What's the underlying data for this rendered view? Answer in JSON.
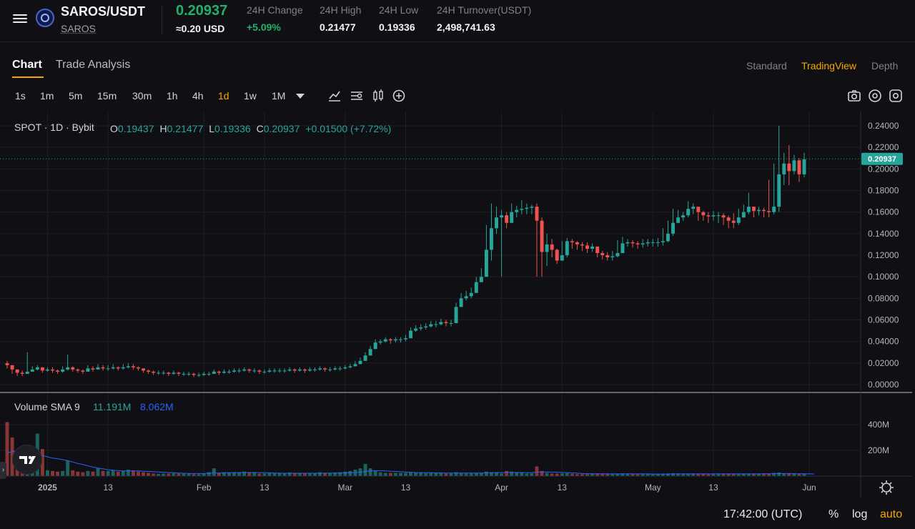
{
  "header": {
    "pair": "SAROS/USDT",
    "subtitle": "SAROS",
    "last_price": "0.20937",
    "price_usd": "≈0.20 USD",
    "stats": [
      {
        "label": "24H Change",
        "value": "+5.09%",
        "positive": true
      },
      {
        "label": "24H High",
        "value": "0.21477",
        "positive": false
      },
      {
        "label": "24H Low",
        "value": "0.19336",
        "positive": false
      },
      {
        "label": "24H Turnover(USDT)",
        "value": "2,498,741.63",
        "positive": false
      }
    ]
  },
  "tabs": {
    "chart": "Chart",
    "trade_analysis": "Trade Analysis",
    "views": [
      "Standard",
      "TradingView",
      "Depth"
    ],
    "active_view": "TradingView"
  },
  "toolbar": {
    "timeframes": [
      "1s",
      "1m",
      "5m",
      "15m",
      "30m",
      "1h",
      "4h",
      "1d",
      "1w",
      "1M"
    ],
    "active_timeframe": "1d",
    "icons": [
      "chevron-down-icon",
      "line-chart-icon",
      "indicator-icon",
      "candle-type-icon",
      "add-icon",
      "camera-icon",
      "eye-icon",
      "settings-icon"
    ]
  },
  "legend": {
    "source": "SPOT · 1D · Bybit",
    "open_label": "O",
    "open": "0.19437",
    "high_label": "H",
    "high": "0.21477",
    "low_label": "L",
    "low": "0.19336",
    "close_label": "C",
    "close": "0.20937",
    "change": "+0.01500 (+7.72%)",
    "volume_title": "Volume SMA 9",
    "volume_value": "11.191M",
    "volume_sma": "8.062M"
  },
  "colors": {
    "up": "#26a69a",
    "down": "#ef5350",
    "accent": "#f7a600",
    "green_text": "#20b26c",
    "sma": "#2962ff"
  },
  "chart_data": {
    "type": "candlestick",
    "price_axis_ticks": [
      "0.24000",
      "0.22000",
      "0.20000",
      "0.18000",
      "0.16000",
      "0.14000",
      "0.12000",
      "0.10000",
      "0.08000",
      "0.06000",
      "0.04000",
      "0.02000",
      "0.00000"
    ],
    "price_range": [
      0,
      0.24
    ],
    "current_price_label": "0.20937",
    "volume_axis_ticks": [
      "400M",
      "200M"
    ],
    "volume_range": [
      0,
      400
    ],
    "time_ticks": [
      {
        "label": "2025",
        "day": 8
      },
      {
        "label": "13",
        "day": 20
      },
      {
        "label": "Feb",
        "day": 39
      },
      {
        "label": "13",
        "day": 51
      },
      {
        "label": "Mar",
        "day": 67
      },
      {
        "label": "13",
        "day": 79
      },
      {
        "label": "Apr",
        "day": 98
      },
      {
        "label": "13",
        "day": 110
      },
      {
        "label": "May",
        "day": 128
      },
      {
        "label": "13",
        "day": 140
      },
      {
        "label": "Jun",
        "day": 159
      }
    ],
    "closes": [
      0.018,
      0.014,
      0.011,
      0.01,
      0.012,
      0.014,
      0.016,
      0.013,
      0.014,
      0.013,
      0.012,
      0.014,
      0.016,
      0.014,
      0.013,
      0.012,
      0.015,
      0.014,
      0.016,
      0.015,
      0.015,
      0.016,
      0.015,
      0.016,
      0.017,
      0.016,
      0.015,
      0.013,
      0.012,
      0.011,
      0.011,
      0.011,
      0.01,
      0.011,
      0.01,
      0.01,
      0.01,
      0.009,
      0.009,
      0.01,
      0.01,
      0.012,
      0.011,
      0.012,
      0.012,
      0.013,
      0.013,
      0.014,
      0.013,
      0.013,
      0.012,
      0.012,
      0.013,
      0.013,
      0.013,
      0.013,
      0.014,
      0.013,
      0.014,
      0.013,
      0.014,
      0.014,
      0.015,
      0.014,
      0.014,
      0.015,
      0.015,
      0.016,
      0.017,
      0.019,
      0.022,
      0.027,
      0.033,
      0.039,
      0.04,
      0.042,
      0.041,
      0.042,
      0.042,
      0.043,
      0.05,
      0.052,
      0.053,
      0.054,
      0.056,
      0.056,
      0.058,
      0.057,
      0.057,
      0.072,
      0.08,
      0.082,
      0.085,
      0.095,
      0.1,
      0.125,
      0.145,
      0.155,
      0.157,
      0.15,
      0.16,
      0.162,
      0.163,
      0.164,
      0.165,
      0.152,
      0.123,
      0.13,
      0.125,
      0.115,
      0.12,
      0.133,
      0.132,
      0.13,
      0.129,
      0.126,
      0.128,
      0.122,
      0.12,
      0.118,
      0.119,
      0.122,
      0.131,
      0.132,
      0.131,
      0.13,
      0.131,
      0.132,
      0.132,
      0.132,
      0.133,
      0.14,
      0.15,
      0.155,
      0.157,
      0.163,
      0.165,
      0.16,
      0.157,
      0.156,
      0.157,
      0.157,
      0.155,
      0.152,
      0.15,
      0.155,
      0.16,
      0.165,
      0.161,
      0.162,
      0.161,
      0.16,
      0.165,
      0.195,
      0.205,
      0.198,
      0.208,
      0.195,
      0.209
    ],
    "highs": [
      0.022,
      0.016,
      0.014,
      0.013,
      0.03,
      0.017,
      0.018,
      0.016,
      0.016,
      0.016,
      0.014,
      0.017,
      0.028,
      0.017,
      0.015,
      0.014,
      0.018,
      0.017,
      0.019,
      0.018,
      0.018,
      0.019,
      0.017,
      0.019,
      0.02,
      0.019,
      0.017,
      0.015,
      0.014,
      0.013,
      0.013,
      0.013,
      0.012,
      0.013,
      0.012,
      0.012,
      0.012,
      0.011,
      0.011,
      0.012,
      0.012,
      0.014,
      0.013,
      0.014,
      0.014,
      0.015,
      0.015,
      0.016,
      0.015,
      0.015,
      0.014,
      0.014,
      0.015,
      0.015,
      0.015,
      0.015,
      0.016,
      0.015,
      0.016,
      0.015,
      0.016,
      0.016,
      0.017,
      0.016,
      0.016,
      0.017,
      0.017,
      0.018,
      0.019,
      0.022,
      0.025,
      0.03,
      0.036,
      0.042,
      0.042,
      0.044,
      0.043,
      0.044,
      0.044,
      0.046,
      0.053,
      0.055,
      0.056,
      0.057,
      0.059,
      0.059,
      0.061,
      0.06,
      0.06,
      0.076,
      0.085,
      0.087,
      0.09,
      0.1,
      0.108,
      0.148,
      0.168,
      0.165,
      0.162,
      0.16,
      0.168,
      0.166,
      0.171,
      0.168,
      0.167,
      0.168,
      0.155,
      0.14,
      0.135,
      0.126,
      0.133,
      0.136,
      0.135,
      0.133,
      0.132,
      0.132,
      0.131,
      0.127,
      0.124,
      0.123,
      0.124,
      0.134,
      0.137,
      0.135,
      0.134,
      0.133,
      0.135,
      0.135,
      0.135,
      0.136,
      0.145,
      0.152,
      0.163,
      0.162,
      0.16,
      0.17,
      0.168,
      0.165,
      0.161,
      0.16,
      0.161,
      0.16,
      0.159,
      0.157,
      0.159,
      0.163,
      0.167,
      0.178,
      0.163,
      0.165,
      0.164,
      0.19,
      0.205,
      0.24,
      0.215,
      0.222,
      0.213,
      0.21,
      0.215
    ],
    "lows": [
      0.015,
      0.01,
      0.008,
      0.008,
      0.01,
      0.012,
      0.013,
      0.011,
      0.012,
      0.011,
      0.01,
      0.011,
      0.013,
      0.012,
      0.011,
      0.01,
      0.012,
      0.012,
      0.014,
      0.013,
      0.013,
      0.014,
      0.013,
      0.014,
      0.015,
      0.014,
      0.013,
      0.011,
      0.01,
      0.009,
      0.009,
      0.009,
      0.008,
      0.009,
      0.008,
      0.008,
      0.008,
      0.007,
      0.007,
      0.008,
      0.008,
      0.01,
      0.009,
      0.01,
      0.01,
      0.011,
      0.011,
      0.012,
      0.011,
      0.011,
      0.01,
      0.01,
      0.011,
      0.011,
      0.011,
      0.011,
      0.012,
      0.011,
      0.012,
      0.011,
      0.012,
      0.012,
      0.013,
      0.012,
      0.012,
      0.013,
      0.013,
      0.014,
      0.015,
      0.017,
      0.019,
      0.024,
      0.03,
      0.036,
      0.037,
      0.039,
      0.038,
      0.039,
      0.039,
      0.04,
      0.047,
      0.049,
      0.05,
      0.051,
      0.053,
      0.053,
      0.055,
      0.054,
      0.054,
      0.065,
      0.075,
      0.078,
      0.08,
      0.09,
      0.095,
      0.1,
      0.115,
      0.14,
      0.1,
      0.145,
      0.15,
      0.155,
      0.158,
      0.158,
      0.158,
      0.1,
      0.1,
      0.11,
      0.118,
      0.112,
      0.115,
      0.118,
      0.126,
      0.125,
      0.124,
      0.122,
      0.123,
      0.118,
      0.116,
      0.115,
      0.115,
      0.118,
      0.125,
      0.128,
      0.127,
      0.126,
      0.127,
      0.128,
      0.128,
      0.128,
      0.129,
      0.132,
      0.138,
      0.15,
      0.152,
      0.155,
      0.158,
      0.152,
      0.152,
      0.15,
      0.152,
      0.15,
      0.148,
      0.145,
      0.145,
      0.148,
      0.155,
      0.158,
      0.155,
      0.157,
      0.155,
      0.155,
      0.158,
      0.16,
      0.185,
      0.185,
      0.195,
      0.188,
      0.192
    ],
    "volumes": [
      420,
      300,
      60,
      40,
      110,
      45,
      330,
      210,
      45,
      40,
      35,
      40,
      120,
      45,
      35,
      30,
      40,
      35,
      60,
      40,
      40,
      45,
      35,
      40,
      50,
      45,
      35,
      30,
      25,
      20,
      18,
      20,
      20,
      22,
      20,
      18,
      18,
      15,
      15,
      18,
      30,
      60,
      25,
      30,
      25,
      30,
      28,
      35,
      25,
      25,
      20,
      20,
      22,
      22,
      25,
      20,
      28,
      20,
      25,
      20,
      25,
      25,
      30,
      25,
      25,
      28,
      30,
      35,
      40,
      50,
      60,
      95,
      60,
      40,
      30,
      25,
      25,
      25,
      25,
      25,
      30,
      25,
      25,
      22,
      25,
      25,
      22,
      20,
      20,
      30,
      25,
      20,
      22,
      25,
      25,
      35,
      30,
      25,
      20,
      40,
      35,
      25,
      25,
      20,
      22,
      75,
      40,
      25,
      20,
      20,
      22,
      22,
      18,
      15,
      15,
      15,
      18,
      20,
      18,
      15,
      15,
      18,
      20,
      18,
      15,
      15,
      15,
      15,
      14,
      14,
      15,
      20,
      22,
      20,
      18,
      20,
      18,
      18,
      15,
      15,
      15,
      15,
      18,
      18,
      15,
      15,
      18,
      20,
      18,
      18,
      18,
      20,
      25,
      28,
      20,
      18,
      20,
      15,
      18,
      15,
      11
    ],
    "volume_sma": [
      180,
      190,
      195,
      200,
      190,
      180,
      170,
      160,
      150,
      140,
      135,
      128,
      120,
      110,
      98,
      90,
      80,
      70,
      62,
      56,
      50,
      46,
      42,
      40,
      40,
      40,
      40,
      38,
      36,
      34,
      32,
      30,
      28,
      26,
      24,
      22,
      20,
      20,
      20,
      20,
      22,
      24,
      24,
      25,
      26,
      27,
      27,
      28,
      28,
      28,
      27,
      26,
      25,
      24,
      23,
      22,
      22,
      22,
      22,
      22,
      22,
      22,
      23,
      23,
      23,
      24,
      24,
      25,
      26,
      28,
      31,
      36,
      40,
      42,
      42,
      40,
      38,
      36,
      34,
      32,
      30,
      28,
      27,
      26,
      26,
      25,
      25,
      24,
      24,
      24,
      24,
      24,
      24,
      24,
      24,
      25,
      26,
      27,
      27,
      28,
      28,
      28,
      28,
      27,
      27,
      30,
      32,
      32,
      31,
      30,
      29,
      27,
      25,
      23,
      20,
      19,
      18,
      18,
      18,
      17,
      17,
      17,
      18,
      18,
      17,
      17,
      17,
      17,
      16,
      16,
      16,
      16,
      17,
      17,
      17,
      17,
      17,
      17,
      17,
      17,
      17,
      17,
      17,
      17,
      17,
      17,
      17,
      17,
      17,
      17,
      18,
      18,
      19,
      20,
      20,
      20,
      19,
      18,
      18,
      17,
      16
    ]
  },
  "footer": {
    "time": "17:42:00 (UTC)",
    "percent": "%",
    "log": "log",
    "auto": "auto"
  }
}
